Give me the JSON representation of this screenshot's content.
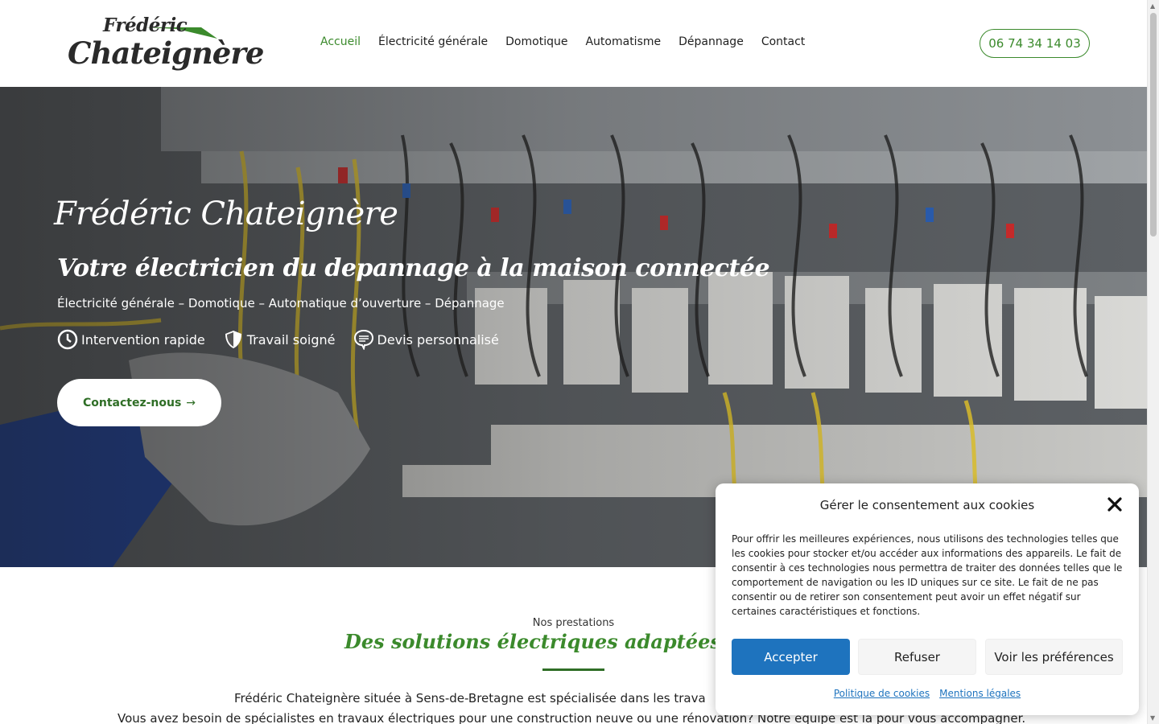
{
  "header": {
    "logo_line1": "Frédéric",
    "logo_line2": "Chateignère",
    "nav": [
      {
        "label": "Accueil"
      },
      {
        "label": "Électricité générale"
      },
      {
        "label": "Domotique"
      },
      {
        "label": "Automatisme"
      },
      {
        "label": "Dépannage"
      },
      {
        "label": "Contact"
      }
    ],
    "phone": "06 74 34 14 03"
  },
  "hero": {
    "title": "Frédéric Chateignère",
    "subtitle": "Votre électricien du depannage à la maison connectée",
    "services": "Électricité générale – Domotique – Automatique d’ouverture – Dépannage",
    "features": [
      {
        "label": "Intervention rapide",
        "icon": "clock-icon"
      },
      {
        "label": "Travail soigné",
        "icon": "shield-icon"
      },
      {
        "label": "Devis personnalisé",
        "icon": "chat-bubble-icon"
      }
    ],
    "cta_label": "Contactez-nous",
    "cta_arrow": "→"
  },
  "services_section": {
    "kicker": "Nos prestations",
    "title": "Des solutions électriques adaptées a chaq",
    "paragraph1": "Frédéric Chateignère située à  Sens-de-Bretagne est spécialisée dans les trava",
    "paragraph2": "Vous avez besoin de spécialistes en travaux électriques pour une construction neuve ou une rénovation? Notre équipe est là pour vous accompagner."
  },
  "cookie_dialog": {
    "title": "Gérer le consentement aux cookies",
    "text": "Pour offrir les meilleures expériences, nous utilisons des technologies telles que les cookies pour stocker et/ou accéder aux informations des appareils. Le fait de consentir à ces technologies nous permettra de traiter des données telles que le comportement de navigation ou les ID uniques sur ce site. Le fait de ne pas consentir ou de retirer son consentement peut avoir un effet négatif sur certaines caractéristiques et fonctions.",
    "accept_label": "Accepter",
    "refuse_label": "Refuser",
    "prefs_label": "Voir les préférences",
    "link_cookies": "Politique de cookies",
    "link_legal": "Mentions légales"
  },
  "colors": {
    "brand_green": "#3b8a2c",
    "accept_blue": "#1e73be"
  }
}
